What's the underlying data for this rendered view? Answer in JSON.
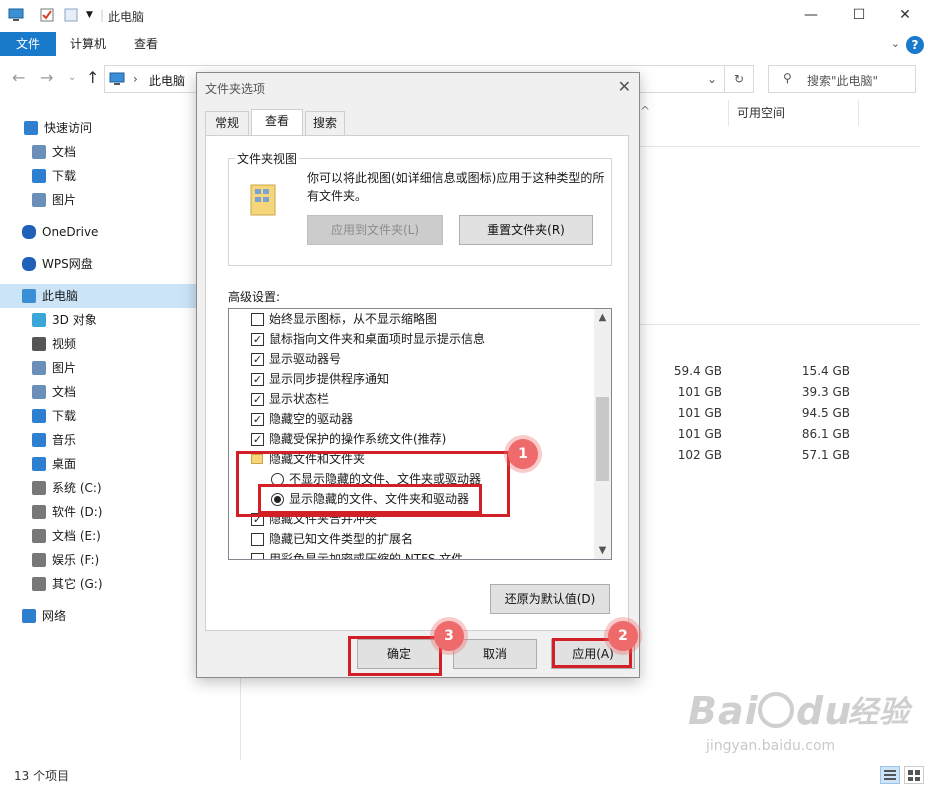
{
  "window": {
    "title": "此电脑"
  },
  "ribbon": {
    "file": "文件",
    "tabs": [
      "计算机",
      "查看"
    ],
    "help": "?"
  },
  "address": {
    "path": "此电脑",
    "search_placeholder": "搜索\"此电脑\""
  },
  "columns": {
    "free_space": "可用空间"
  },
  "sidebar": {
    "items": [
      {
        "label": "快速访问",
        "icon": "star-icon"
      },
      {
        "label": "文档",
        "icon": "document-icon"
      },
      {
        "label": "下载",
        "icon": "download-icon"
      },
      {
        "label": "图片",
        "icon": "picture-icon"
      },
      {
        "label": "OneDrive",
        "icon": "cloud-icon"
      },
      {
        "label": "WPS网盘",
        "icon": "cloud-icon"
      },
      {
        "label": "此电脑",
        "icon": "computer-icon"
      },
      {
        "label": "3D 对象",
        "icon": "cube-icon"
      },
      {
        "label": "视频",
        "icon": "video-icon"
      },
      {
        "label": "图片",
        "icon": "picture-icon"
      },
      {
        "label": "文档",
        "icon": "document-icon"
      },
      {
        "label": "下载",
        "icon": "download-icon"
      },
      {
        "label": "音乐",
        "icon": "music-icon"
      },
      {
        "label": "桌面",
        "icon": "desktop-icon"
      },
      {
        "label": "系统 (C:)",
        "icon": "drive-icon"
      },
      {
        "label": "软件 (D:)",
        "icon": "drive-icon"
      },
      {
        "label": "文档 (E:)",
        "icon": "drive-icon"
      },
      {
        "label": "娱乐 (F:)",
        "icon": "drive-icon"
      },
      {
        "label": "其它 (G:)",
        "icon": "drive-icon"
      },
      {
        "label": "网络",
        "icon": "network-icon"
      }
    ]
  },
  "drives": [
    {
      "total": "59.4 GB",
      "free": "15.4 GB"
    },
    {
      "total": "101 GB",
      "free": "39.3 GB"
    },
    {
      "total": "101 GB",
      "free": "94.5 GB"
    },
    {
      "total": "101 GB",
      "free": "86.1 GB"
    },
    {
      "total": "102 GB",
      "free": "57.1 GB"
    }
  ],
  "status": {
    "count": "13 个项目"
  },
  "dialog": {
    "title": "文件夹选项",
    "tabs": [
      "常规",
      "查看",
      "搜索"
    ],
    "folder_view": {
      "title": "文件夹视图",
      "description": "你可以将此视图(如详细信息或图标)应用于这种类型的所有文件夹。",
      "apply_button": "应用到文件夹(L)",
      "reset_button": "重置文件夹(R)"
    },
    "advanced_label": "高级设置:",
    "settings": [
      {
        "type": "checkbox",
        "checked": false,
        "label": "始终显示图标，从不显示缩略图"
      },
      {
        "type": "checkbox",
        "checked": true,
        "label": "鼠标指向文件夹和桌面项时显示提示信息"
      },
      {
        "type": "checkbox",
        "checked": true,
        "label": "显示驱动器号"
      },
      {
        "type": "checkbox",
        "checked": true,
        "label": "显示同步提供程序通知"
      },
      {
        "type": "checkbox",
        "checked": true,
        "label": "显示状态栏"
      },
      {
        "type": "checkbox",
        "checked": true,
        "label": "隐藏空的驱动器"
      },
      {
        "type": "checkbox",
        "checked": true,
        "label": "隐藏受保护的操作系统文件(推荐)"
      },
      {
        "type": "folder",
        "label": "隐藏文件和文件夹"
      },
      {
        "type": "radio",
        "checked": false,
        "label": "不显示隐藏的文件、文件夹或驱动器"
      },
      {
        "type": "radio",
        "checked": true,
        "label": "显示隐藏的文件、文件夹和驱动器"
      },
      {
        "type": "checkbox",
        "checked": true,
        "label": "隐藏文件夹合并冲突"
      },
      {
        "type": "checkbox",
        "checked": false,
        "label": "隐藏已知文件类型的扩展名"
      },
      {
        "type": "checkbox",
        "checked": false,
        "label": "用彩色显示加密或压缩的 NTFS 文件"
      }
    ],
    "restore_button": "还原为默认值(D)",
    "ok_button": "确定",
    "cancel_button": "取消",
    "apply_button": "应用(A)"
  },
  "annotations": {
    "badge1": "1",
    "badge2": "2",
    "badge3": "3"
  },
  "watermark": {
    "brand": "Bai du 经验",
    "url": "jingyan.baidu.com"
  }
}
